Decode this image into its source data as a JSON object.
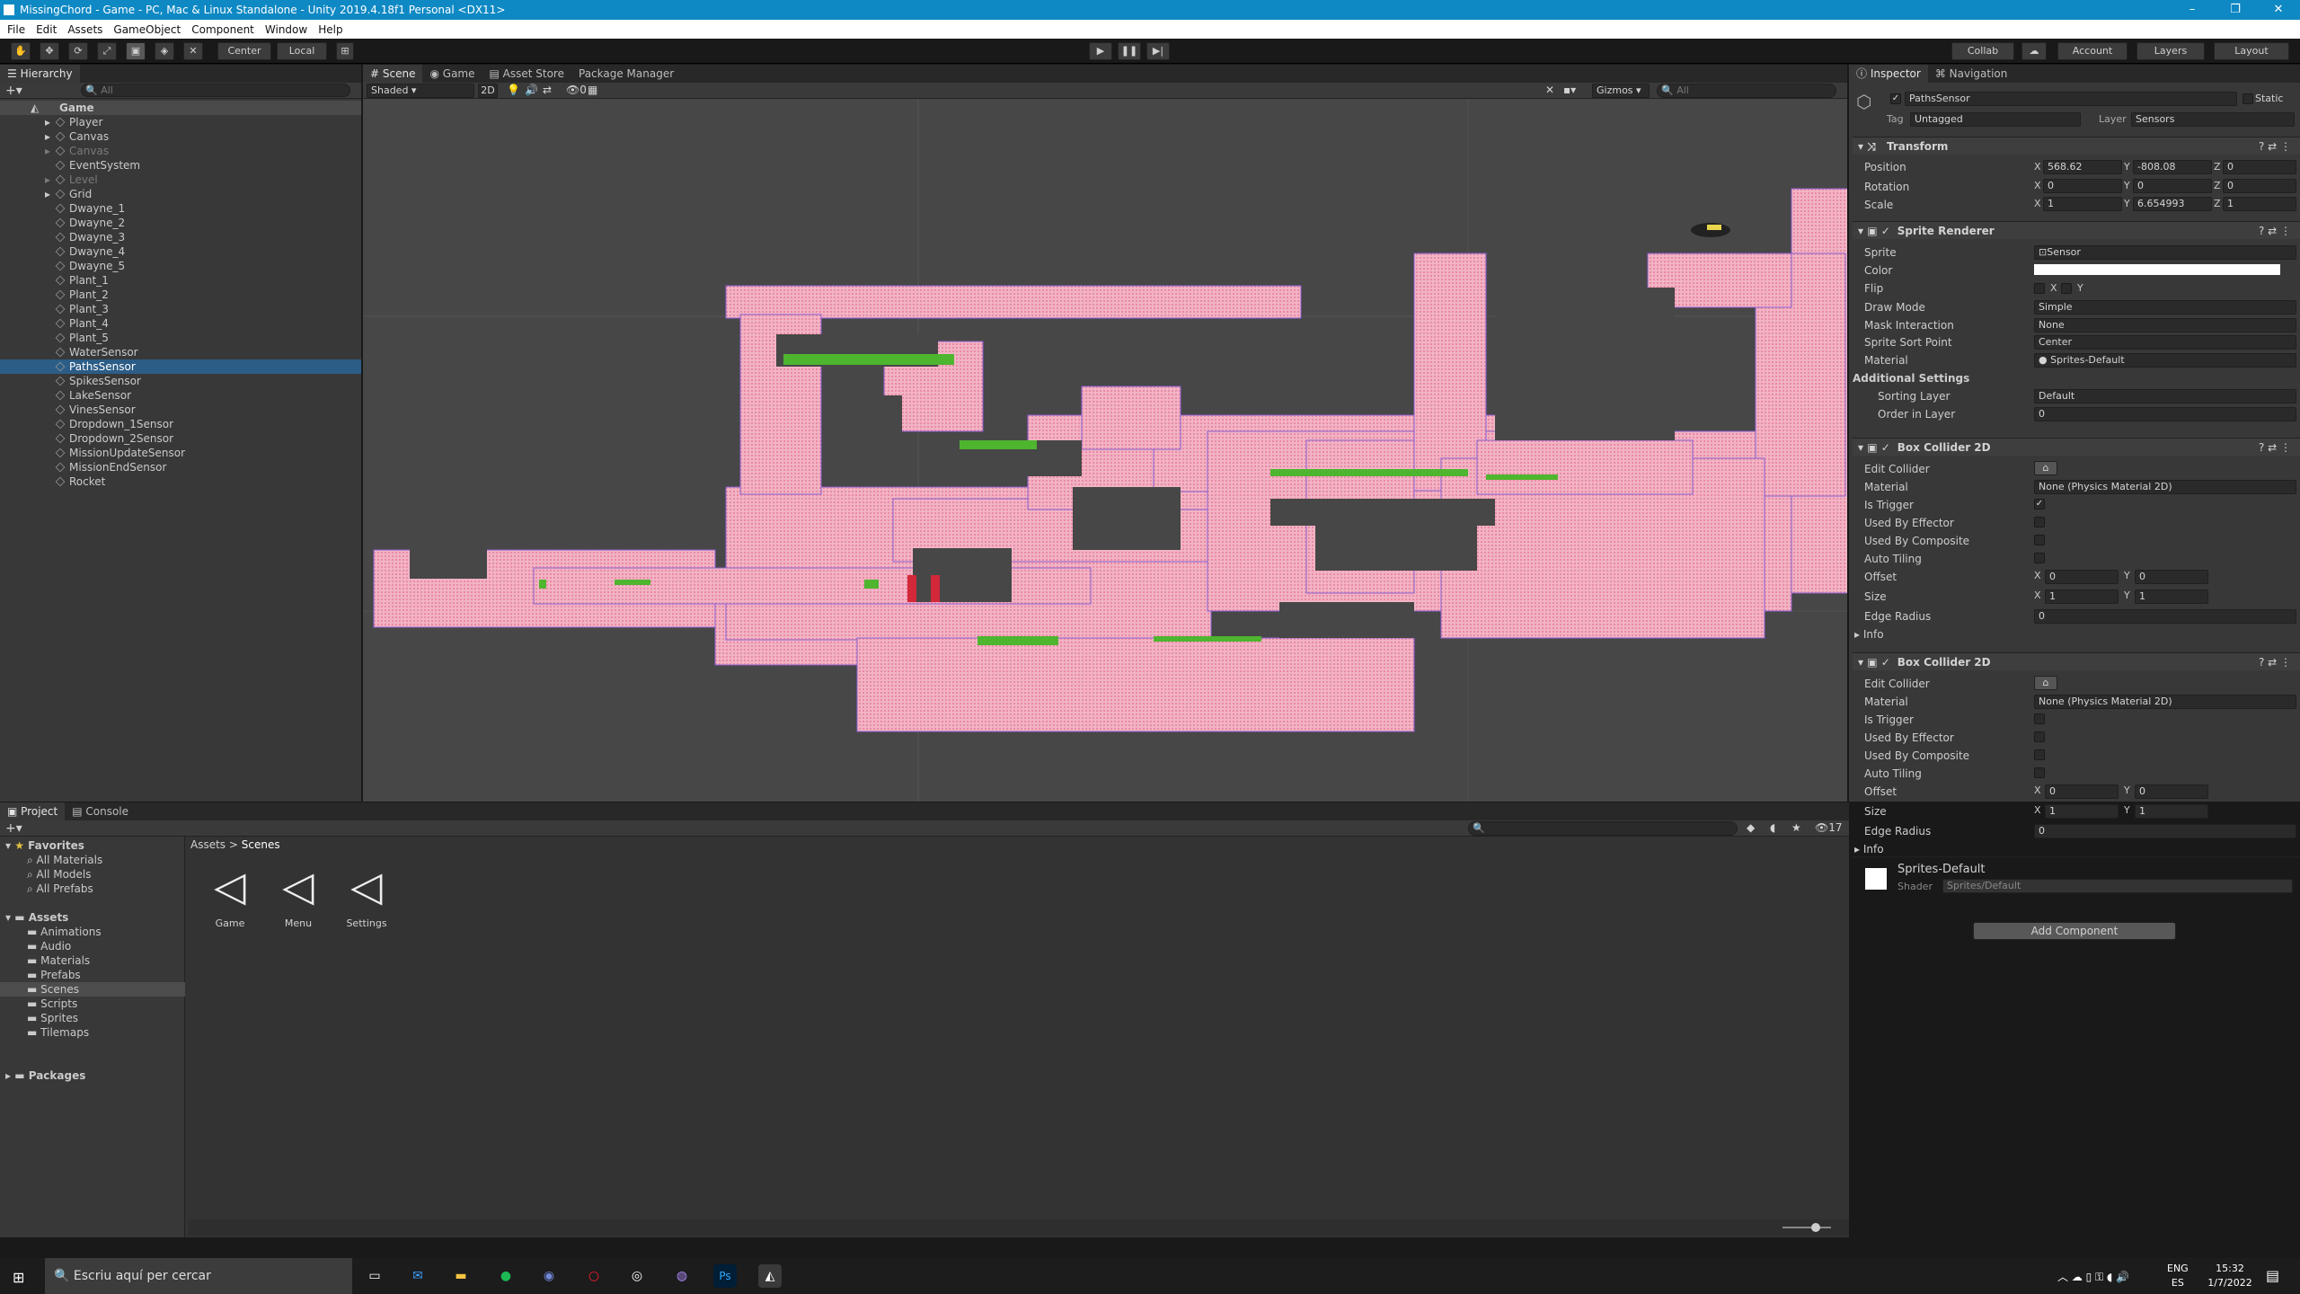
{
  "app": {
    "title": "MissingChord - Game - PC, Mac & Linux Standalone - Unity 2019.4.18f1 Personal <DX11>"
  },
  "menu": [
    "File",
    "Edit",
    "Assets",
    "GameObject",
    "Component",
    "Window",
    "Help"
  ],
  "toolbar": {
    "pivot": "Center",
    "space": "Local",
    "collab": "Collab",
    "account": "Account",
    "layers": "Layers",
    "layout": "Layout"
  },
  "hierarchy": {
    "tab": "Hierarchy",
    "search": "All",
    "root": "Game",
    "items": [
      {
        "label": "Player",
        "dim": false,
        "arrow": true
      },
      {
        "label": "Canvas",
        "dim": false,
        "arrow": true
      },
      {
        "label": "Canvas",
        "dim": true,
        "arrow": true
      },
      {
        "label": "EventSystem",
        "dim": false,
        "arrow": false
      },
      {
        "label": "Level",
        "dim": true,
        "arrow": true
      },
      {
        "label": "Grid",
        "dim": false,
        "arrow": true
      },
      {
        "label": "Dwayne_1",
        "dim": false,
        "arrow": false
      },
      {
        "label": "Dwayne_2",
        "dim": false,
        "arrow": false
      },
      {
        "label": "Dwayne_3",
        "dim": false,
        "arrow": false
      },
      {
        "label": "Dwayne_4",
        "dim": false,
        "arrow": false
      },
      {
        "label": "Dwayne_5",
        "dim": false,
        "arrow": false
      },
      {
        "label": "Plant_1",
        "dim": false,
        "arrow": false
      },
      {
        "label": "Plant_2",
        "dim": false,
        "arrow": false
      },
      {
        "label": "Plant_3",
        "dim": false,
        "arrow": false
      },
      {
        "label": "Plant_4",
        "dim": false,
        "arrow": false
      },
      {
        "label": "Plant_5",
        "dim": false,
        "arrow": false
      },
      {
        "label": "WaterSensor",
        "dim": false,
        "arrow": false
      },
      {
        "label": "PathsSensor",
        "dim": false,
        "arrow": false,
        "selected": true
      },
      {
        "label": "SpikesSensor",
        "dim": false,
        "arrow": false
      },
      {
        "label": "LakeSensor",
        "dim": false,
        "arrow": false
      },
      {
        "label": "VinesSensor",
        "dim": false,
        "arrow": false
      },
      {
        "label": "Dropdown_1Sensor",
        "dim": false,
        "arrow": false
      },
      {
        "label": "Dropdown_2Sensor",
        "dim": false,
        "arrow": false
      },
      {
        "label": "MissionUpdateSensor",
        "dim": false,
        "arrow": false
      },
      {
        "label": "MissionEndSensor",
        "dim": false,
        "arrow": false
      },
      {
        "label": "Rocket",
        "dim": false,
        "arrow": false
      }
    ]
  },
  "scene": {
    "tabs": [
      "Scene",
      "Game",
      "Asset Store",
      "Package Manager"
    ],
    "shading": "Shaded",
    "mode2d": "2D",
    "gizmos": "Gizmos",
    "search": "All",
    "hidden_count": "0"
  },
  "inspector": {
    "tabs": [
      "Inspector",
      "Navigation"
    ],
    "object_name": "PathsSensor",
    "static": "Static",
    "tag_label": "Tag",
    "tag": "Untagged",
    "layer_label": "Layer",
    "layer": "Sensors",
    "transform": {
      "title": "Transform",
      "position": {
        "label": "Position",
        "x": "568.62",
        "y": "-808.08",
        "z": "0"
      },
      "rotation": {
        "label": "Rotation",
        "x": "0",
        "y": "0",
        "z": "0"
      },
      "scale": {
        "label": "Scale",
        "x": "1",
        "y": "6.654993",
        "z": "1"
      }
    },
    "sprite_renderer": {
      "title": "Sprite Renderer",
      "sprite_label": "Sprite",
      "sprite": "Sensor",
      "color_label": "Color",
      "flip_label": "Flip",
      "draw_mode_label": "Draw Mode",
      "draw_mode": "Simple",
      "mask_label": "Mask Interaction",
      "mask": "None",
      "sort_point_label": "Sprite Sort Point",
      "sort_point": "Center",
      "material_label": "Material",
      "material": "Sprites-Default",
      "additional": "Additional Settings",
      "sorting_layer_label": "Sorting Layer",
      "sorting_layer": "Default",
      "order_label": "Order in Layer",
      "order": "0"
    },
    "box_collider_1": {
      "title": "Box Collider 2D",
      "edit": "Edit Collider",
      "material_label": "Material",
      "material": "None (Physics Material 2D)",
      "is_trigger": "Is Trigger",
      "trigger_on": true,
      "used_effector": "Used By Effector",
      "used_composite": "Used By Composite",
      "auto_tiling": "Auto Tiling",
      "offset_label": "Offset",
      "offset_x": "0",
      "offset_y": "0",
      "size_label": "Size",
      "size_x": "1",
      "size_y": "1",
      "edge_label": "Edge Radius",
      "edge": "0",
      "info": "Info"
    },
    "box_collider_2": {
      "title": "Box Collider 2D",
      "edit": "Edit Collider",
      "material_label": "Material",
      "material": "None (Physics Material 2D)",
      "is_trigger": "Is Trigger",
      "trigger_on": false,
      "used_effector": "Used By Effector",
      "used_composite": "Used By Composite",
      "auto_tiling": "Auto Tiling",
      "offset_label": "Offset",
      "offset_x": "0",
      "offset_y": "0",
      "size_label": "Size",
      "size_x": "1",
      "size_y": "1",
      "edge_label": "Edge Radius",
      "edge": "0",
      "info": "Info"
    },
    "material_preview": {
      "name": "Sprites-Default",
      "shader_label": "Shader",
      "shader": "Sprites/Default"
    },
    "add_component": "Add Component"
  },
  "project": {
    "tabs": [
      "Project",
      "Console"
    ],
    "favorites": "Favorites",
    "fav_items": [
      "All Materials",
      "All Models",
      "All Prefabs"
    ],
    "assets": "Assets",
    "folders": [
      "Animations",
      "Audio",
      "Materials",
      "Prefabs",
      "Scenes",
      "Scripts",
      "Sprites",
      "Tilemaps"
    ],
    "packages": "Packages",
    "breadcrumb": [
      "Assets",
      "Scenes"
    ],
    "scenes": [
      "Game",
      "Menu",
      "Settings"
    ],
    "count": "17"
  },
  "taskbar": {
    "search": "Escriu aquí per cercar",
    "lang1": "ENG",
    "lang2": "ES",
    "time": "15:32",
    "date": "1/7/2022"
  }
}
